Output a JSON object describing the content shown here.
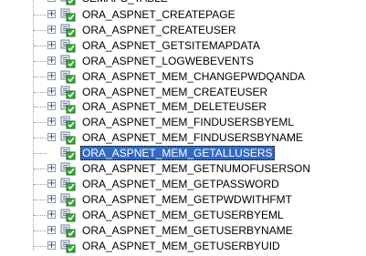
{
  "tree": {
    "items": [
      {
        "label": "ORA_ASPNET_CREATEPAGE",
        "expander": "+",
        "selected": false
      },
      {
        "label": "ORA_ASPNET_CREATEUSER",
        "expander": "+",
        "selected": false
      },
      {
        "label": "ORA_ASPNET_GETSITEMAPDATA",
        "expander": "+",
        "selected": false
      },
      {
        "label": "ORA_ASPNET_LOGWEBEVENTS",
        "expander": "+",
        "selected": false
      },
      {
        "label": "ORA_ASPNET_MEM_CHANGEPWDQANDA",
        "expander": "+",
        "selected": false
      },
      {
        "label": "ORA_ASPNET_MEM_CREATEUSER",
        "expander": "+",
        "selected": false
      },
      {
        "label": "ORA_ASPNET_MEM_DELETEUSER",
        "expander": "+",
        "selected": false
      },
      {
        "label": "ORA_ASPNET_MEM_FINDUSERSBYEML",
        "expander": "+",
        "selected": false
      },
      {
        "label": "ORA_ASPNET_MEM_FINDUSERSBYNAME",
        "expander": "+",
        "selected": false
      },
      {
        "label": "ORA_ASPNET_MEM_GETALLUSERS",
        "expander": "",
        "selected": true
      },
      {
        "label": "ORA_ASPNET_MEM_GETNUMOFUSERSON",
        "expander": "+",
        "selected": false
      },
      {
        "label": "ORA_ASPNET_MEM_GETPASSWORD",
        "expander": "+",
        "selected": false
      },
      {
        "label": "ORA_ASPNET_MEM_GETPWDWITHFMT",
        "expander": "+",
        "selected": false
      },
      {
        "label": "ORA_ASPNET_MEM_GETUSERBYEML",
        "expander": "+",
        "selected": false
      },
      {
        "label": "ORA_ASPNET_MEM_GETUSERBYNAME",
        "expander": "+",
        "selected": false
      },
      {
        "label": "ORA_ASPNET_MEM_GETUSERBYUID",
        "expander": "+",
        "selected": false
      }
    ],
    "top_partial": {
      "label": "SEMAPS_TABLE",
      "expander": "+"
    }
  },
  "colors": {
    "selection": "#316ac5",
    "tree_lines": "#9a9a9a",
    "icon_green": "#2e9a2e"
  },
  "icon_name": "procedure-icon"
}
